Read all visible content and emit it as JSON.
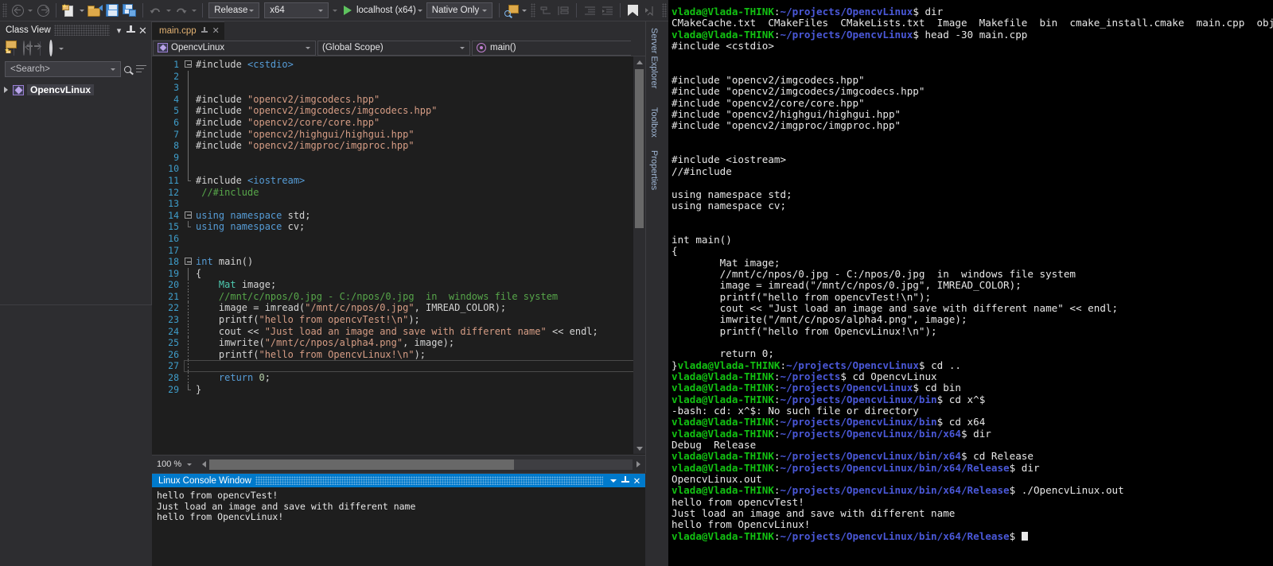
{
  "toolbar": {
    "nav_back": "navigate-backward",
    "nav_forward": "navigate-forward",
    "new_item": "new-item",
    "open_file": "open-file",
    "save": "save",
    "save_all": "save-all",
    "undo": "undo",
    "redo": "redo",
    "config_combo": "Release",
    "platform_combo": "x64",
    "run_label": "localhost (x64)",
    "debug_combo": "Native Only",
    "find_icon": "find-in-files-icon",
    "bookmark_icon": "bookmark-icon"
  },
  "class_view": {
    "title": "Class View",
    "search_placeholder": "<Search>",
    "tree": [
      {
        "label": "OpencvLinux",
        "icon": "namespace-icon"
      }
    ]
  },
  "editor": {
    "tab": "main.cpp",
    "scope_project": "OpencvLinux",
    "scope_global": "(Global Scope)",
    "scope_member": "main()",
    "zoom": "100 %",
    "lines": [
      {
        "n": "1",
        "fold": "open",
        "tokens": [
          [
            "k-pp",
            "#include "
          ],
          [
            "k-blue",
            "<cstdio>"
          ]
        ]
      },
      {
        "n": "2",
        "fold": "line",
        "tokens": []
      },
      {
        "n": "3",
        "fold": "line",
        "tokens": []
      },
      {
        "n": "4",
        "fold": "line",
        "tokens": [
          [
            "k-pp",
            "#include "
          ],
          [
            "k-str",
            "\"opencv2/imgcodecs.hpp\""
          ]
        ]
      },
      {
        "n": "5",
        "fold": "line",
        "tokens": [
          [
            "k-pp",
            "#include "
          ],
          [
            "k-str",
            "\"opencv2/imgcodecs/imgcodecs.hpp\""
          ]
        ]
      },
      {
        "n": "6",
        "fold": "line",
        "tokens": [
          [
            "k-pp",
            "#include "
          ],
          [
            "k-str",
            "\"opencv2/core/core.hpp\""
          ]
        ]
      },
      {
        "n": "7",
        "fold": "line",
        "tokens": [
          [
            "k-pp",
            "#include "
          ],
          [
            "k-str",
            "\"opencv2/highgui/highgui.hpp\""
          ]
        ]
      },
      {
        "n": "8",
        "fold": "line",
        "tokens": [
          [
            "k-pp",
            "#include "
          ],
          [
            "k-str",
            "\"opencv2/imgproc/imgproc.hpp\""
          ]
        ]
      },
      {
        "n": "9",
        "fold": "line",
        "tokens": []
      },
      {
        "n": "10",
        "fold": "line",
        "tokens": []
      },
      {
        "n": "11",
        "fold": "end",
        "tokens": [
          [
            "k-pp",
            "#include "
          ],
          [
            "k-blue",
            "<iostream>"
          ]
        ]
      },
      {
        "n": "12",
        "fold": "none",
        "tokens": [
          [
            "k-com",
            " //#include"
          ]
        ]
      },
      {
        "n": "13",
        "fold": "none",
        "tokens": []
      },
      {
        "n": "14",
        "fold": "open",
        "tokens": [
          [
            "k-blue",
            "using namespace"
          ],
          [
            "k-pp",
            " std;"
          ]
        ]
      },
      {
        "n": "15",
        "fold": "end",
        "tokens": [
          [
            "k-blue",
            "using namespace"
          ],
          [
            "k-pp",
            " cv;"
          ]
        ]
      },
      {
        "n": "16",
        "fold": "none",
        "tokens": []
      },
      {
        "n": "17",
        "fold": "none",
        "tokens": []
      },
      {
        "n": "18",
        "fold": "open",
        "tokens": [
          [
            "k-blue",
            "int"
          ],
          [
            "k-pp",
            " main()"
          ]
        ]
      },
      {
        "n": "19",
        "fold": "vline",
        "tokens": [
          [
            "k-pp",
            "{"
          ]
        ]
      },
      {
        "n": "20",
        "fold": "vdash",
        "tokens": [
          [
            "k-pp",
            "    "
          ],
          [
            "k-type",
            "Mat"
          ],
          [
            "k-pp",
            " image;"
          ]
        ]
      },
      {
        "n": "21",
        "fold": "vdash",
        "tokens": [
          [
            "k-pp",
            "    "
          ],
          [
            "k-com",
            "//mnt/c/npos/0.jpg - C:/npos/0.jpg  in  windows file system"
          ]
        ]
      },
      {
        "n": "22",
        "fold": "vdash",
        "tokens": [
          [
            "k-pp",
            "    image = imread("
          ],
          [
            "k-str",
            "\"/mnt/c/npos/0.jpg\""
          ],
          [
            "k-pp",
            ", IMREAD_COLOR);"
          ]
        ]
      },
      {
        "n": "23",
        "fold": "vdash",
        "tokens": [
          [
            "k-pp",
            "    printf("
          ],
          [
            "k-str",
            "\"hello from opencvTest!\\n\""
          ],
          [
            "k-pp",
            ");"
          ]
        ]
      },
      {
        "n": "24",
        "fold": "vdash",
        "tokens": [
          [
            "k-pp",
            "    cout << "
          ],
          [
            "k-str",
            "\"Just load an image and save with different name\""
          ],
          [
            "k-pp",
            " << endl;"
          ]
        ]
      },
      {
        "n": "25",
        "fold": "vdash",
        "tokens": [
          [
            "k-pp",
            "    imwrite("
          ],
          [
            "k-str",
            "\"/mnt/c/npos/alpha4.png\""
          ],
          [
            "k-pp",
            ", image);"
          ]
        ]
      },
      {
        "n": "26",
        "fold": "vdash",
        "tokens": [
          [
            "k-pp",
            "    printf("
          ],
          [
            "k-str",
            "\"hello from OpencvLinux!\\n\""
          ],
          [
            "k-pp",
            ");"
          ]
        ]
      },
      {
        "n": "27",
        "fold": "vdash",
        "tokens": [],
        "caret": true
      },
      {
        "n": "28",
        "fold": "vdash",
        "tokens": [
          [
            "k-pp",
            "    "
          ],
          [
            "k-blue",
            "return"
          ],
          [
            "k-pp",
            " "
          ],
          [
            "k-num",
            "0"
          ],
          [
            "k-pp",
            ";"
          ]
        ]
      },
      {
        "n": "29",
        "fold": "vend",
        "tokens": [
          [
            "k-pp",
            "}"
          ]
        ]
      }
    ]
  },
  "dock_tabs": [
    {
      "label": "Server Explorer"
    },
    {
      "label": "Toolbox"
    },
    {
      "label": "Properties"
    }
  ],
  "console": {
    "title": "Linux Console Window",
    "lines": [
      "hello from opencvTest!",
      "Just load an image and save with different name",
      "hello from OpencvLinux!"
    ]
  },
  "terminal": {
    "user": "vlada@Vlada-THINK",
    "colors": {
      "user": "#12c112",
      "path": "#4a58d8",
      "text": "#e8e8e8"
    },
    "lines": [
      {
        "type": "prompt",
        "path": "~/projects/OpencvLinux",
        "cmd": " dir"
      },
      {
        "type": "out",
        "text": "CMakeCache.txt  CMakeFiles  CMakeLists.txt  Image  Makefile  bin  cmake_install.cmake  main.cpp  obj"
      },
      {
        "type": "prompt",
        "path": "~/projects/OpencvLinux",
        "cmd": " head -30 main.cpp"
      },
      {
        "type": "out",
        "text": "#include <cstdio>"
      },
      {
        "type": "out",
        "text": ""
      },
      {
        "type": "out",
        "text": ""
      },
      {
        "type": "out",
        "text": "#include \"opencv2/imgcodecs.hpp\""
      },
      {
        "type": "out",
        "text": "#include \"opencv2/imgcodecs/imgcodecs.hpp\""
      },
      {
        "type": "out",
        "text": "#include \"opencv2/core/core.hpp\""
      },
      {
        "type": "out",
        "text": "#include \"opencv2/highgui/highgui.hpp\""
      },
      {
        "type": "out",
        "text": "#include \"opencv2/imgproc/imgproc.hpp\""
      },
      {
        "type": "out",
        "text": ""
      },
      {
        "type": "out",
        "text": ""
      },
      {
        "type": "out",
        "text": "#include <iostream>"
      },
      {
        "type": "out",
        "text": "//#include"
      },
      {
        "type": "out",
        "text": ""
      },
      {
        "type": "out",
        "text": "using namespace std;"
      },
      {
        "type": "out",
        "text": "using namespace cv;"
      },
      {
        "type": "out",
        "text": ""
      },
      {
        "type": "out",
        "text": ""
      },
      {
        "type": "out",
        "text": "int main()"
      },
      {
        "type": "out",
        "text": "{"
      },
      {
        "type": "out",
        "text": "        Mat image;"
      },
      {
        "type": "out",
        "text": "        //mnt/c/npos/0.jpg - C:/npos/0.jpg  in  windows file system"
      },
      {
        "type": "out",
        "text": "        image = imread(\"/mnt/c/npos/0.jpg\", IMREAD_COLOR);"
      },
      {
        "type": "out",
        "text": "        printf(\"hello from opencvTest!\\n\");"
      },
      {
        "type": "out",
        "text": "        cout << \"Just load an image and save with different name\" << endl;"
      },
      {
        "type": "out",
        "text": "        imwrite(\"/mnt/c/npos/alpha4.png\", image);"
      },
      {
        "type": "out",
        "text": "        printf(\"hello from OpencvLinux!\\n\");"
      },
      {
        "type": "out",
        "text": ""
      },
      {
        "type": "out",
        "text": "        return 0;"
      },
      {
        "type": "prompt",
        "prefix": "}",
        "path": "~/projects/OpencvLinux",
        "cmd": " cd .."
      },
      {
        "type": "prompt",
        "path": "~/projects",
        "cmd": " cd OpencvLinux"
      },
      {
        "type": "prompt",
        "path": "~/projects/OpencvLinux",
        "cmd": " cd bin"
      },
      {
        "type": "prompt",
        "path": "~/projects/OpencvLinux/bin",
        "cmd": " cd x^$"
      },
      {
        "type": "out",
        "text": "-bash: cd: x^$: No such file or directory"
      },
      {
        "type": "prompt",
        "path": "~/projects/OpencvLinux/bin",
        "cmd": " cd x64"
      },
      {
        "type": "prompt",
        "path": "~/projects/OpencvLinux/bin/x64",
        "cmd": " dir"
      },
      {
        "type": "out",
        "text": "Debug  Release"
      },
      {
        "type": "prompt",
        "path": "~/projects/OpencvLinux/bin/x64",
        "cmd": " cd Release"
      },
      {
        "type": "prompt",
        "path": "~/projects/OpencvLinux/bin/x64/Release",
        "cmd": " dir"
      },
      {
        "type": "out",
        "text": "OpencvLinux.out"
      },
      {
        "type": "prompt",
        "path": "~/projects/OpencvLinux/bin/x64/Release",
        "cmd": " ./OpencvLinux.out"
      },
      {
        "type": "out",
        "text": "hello from opencvTest!"
      },
      {
        "type": "out",
        "text": "Just load an image and save with different name"
      },
      {
        "type": "out",
        "text": "hello from OpencvLinux!"
      },
      {
        "type": "prompt",
        "path": "~/projects/OpencvLinux/bin/x64/Release",
        "cmd": " ",
        "cursor": true
      }
    ]
  }
}
